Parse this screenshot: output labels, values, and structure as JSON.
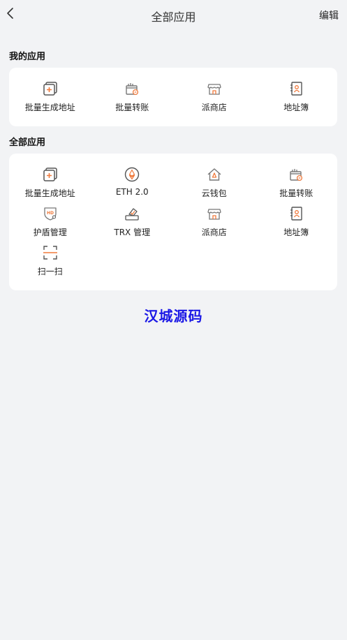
{
  "header": {
    "title": "全部应用",
    "edit_label": "编辑"
  },
  "my_apps": {
    "title": "我的应用",
    "items": [
      {
        "label": "批量生成地址",
        "icon": "batch-generate-address-icon"
      },
      {
        "label": "批量转账",
        "icon": "batch-transfer-icon"
      },
      {
        "label": "派商店",
        "icon": "store-icon"
      },
      {
        "label": "地址簿",
        "icon": "address-book-icon"
      }
    ]
  },
  "all_apps": {
    "title": "全部应用",
    "items": [
      {
        "label": "批量生成地址",
        "icon": "batch-generate-address-icon"
      },
      {
        "label": "ETH 2.0",
        "icon": "eth-icon"
      },
      {
        "label": "云钱包",
        "icon": "cloud-wallet-icon"
      },
      {
        "label": "批量转账",
        "icon": "batch-transfer-icon"
      },
      {
        "label": "护盾管理",
        "icon": "shield-hd-icon"
      },
      {
        "label": "TRX 管理",
        "icon": "trx-vote-icon"
      },
      {
        "label": "派商店",
        "icon": "store-icon"
      },
      {
        "label": "地址簿",
        "icon": "address-book-icon"
      },
      {
        "label": "扫一扫",
        "icon": "scan-icon"
      }
    ]
  },
  "watermark": "汉城源码",
  "colors": {
    "accent": "#f07a3c",
    "icon_gray": "#555555",
    "background": "#f2f3f5",
    "watermark": "#1a17e6"
  }
}
